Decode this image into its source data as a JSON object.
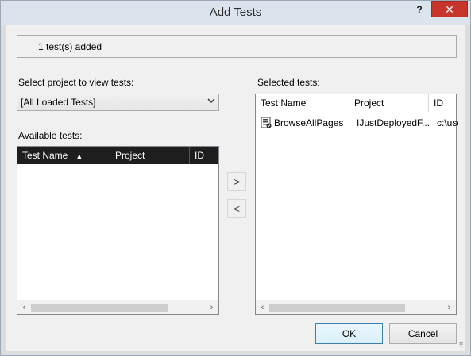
{
  "window": {
    "title": "Add Tests",
    "help_label": "?",
    "close_label": "✕"
  },
  "status": {
    "text": "1 test(s) added"
  },
  "left": {
    "project_label": "Select project to view tests:",
    "project_selected": "[All Loaded Tests]",
    "available_label": "Available tests:",
    "columns": [
      "Test Name",
      "Project",
      "ID"
    ],
    "sorted_column": "Test Name",
    "sort_direction": "ascending",
    "rows": []
  },
  "move": {
    "add_label": ">",
    "remove_label": "<"
  },
  "right": {
    "selected_label": "Selected tests:",
    "columns": [
      "Test Name",
      "Project",
      "ID"
    ],
    "rows": [
      {
        "name": "BrowseAllPages",
        "project": "IJustDeployedF...",
        "id": "c:\\use"
      }
    ]
  },
  "buttons": {
    "ok": "OK",
    "cancel": "Cancel"
  },
  "colors": {
    "close_button": "#c7342c",
    "dark_header": "#1e1e1e",
    "ok_border": "#3c7fb1"
  }
}
